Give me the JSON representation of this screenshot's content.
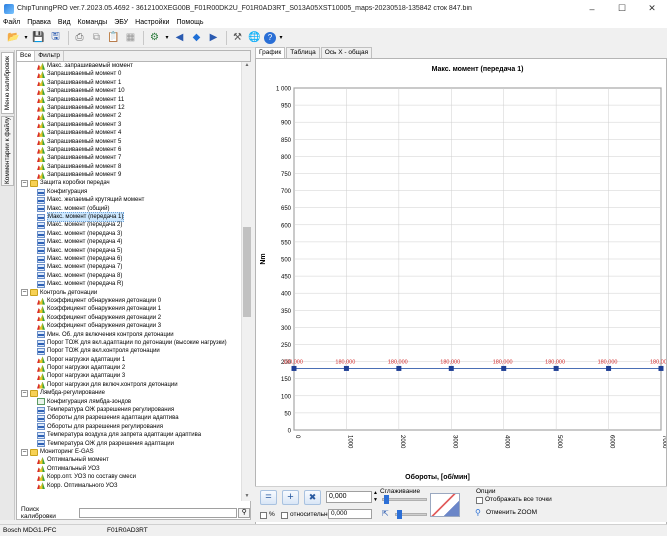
{
  "window": {
    "title": "ChipTuningPRO ver.7.2023.05.4692 - 3612100XEG00B_F01R00DK2U_F01R0AD3RT_S013A05XST10005_maps-20230518-135842 сток 847.bin",
    "minimize": "–",
    "maximize": "☐",
    "close": "✕"
  },
  "menu": [
    "Файл",
    "Правка",
    "Вид",
    "Команды",
    "ЭБУ",
    "Настройки",
    "Помощь"
  ],
  "side_tabs": [
    "Меню калибровок",
    "Комментарии к файлу"
  ],
  "left_tabs": [
    "Все",
    "Фильтр"
  ],
  "tree": [
    {
      "level": 2,
      "icon": "map",
      "label": "Макс. запрашиваемый момент"
    },
    {
      "level": 2,
      "icon": "map",
      "label": "Запрашиваемый момент 0"
    },
    {
      "level": 2,
      "icon": "map",
      "label": "Запрашиваемый момент 1"
    },
    {
      "level": 2,
      "icon": "map",
      "label": "Запрашиваемый момент 10"
    },
    {
      "level": 2,
      "icon": "map",
      "label": "Запрашиваемый момент 11"
    },
    {
      "level": 2,
      "icon": "map",
      "label": "Запрашиваемый момент 12"
    },
    {
      "level": 2,
      "icon": "map",
      "label": "Запрашиваемый момент 2"
    },
    {
      "level": 2,
      "icon": "map",
      "label": "Запрашиваемый момент 3"
    },
    {
      "level": 2,
      "icon": "map",
      "label": "Запрашиваемый момент 4"
    },
    {
      "level": 2,
      "icon": "map",
      "label": "Запрашиваемый момент 5"
    },
    {
      "level": 2,
      "icon": "map",
      "label": "Запрашиваемый момент 6"
    },
    {
      "level": 2,
      "icon": "map",
      "label": "Запрашиваемый момент 7"
    },
    {
      "level": 2,
      "icon": "map",
      "label": "Запрашиваемый момент 8"
    },
    {
      "level": 2,
      "icon": "map",
      "label": "Запрашиваемый момент 9"
    },
    {
      "level": 1,
      "icon": "folder",
      "label": "Защита коробки передач",
      "expander": "–"
    },
    {
      "level": 2,
      "icon": "curve",
      "label": "Конфигурация"
    },
    {
      "level": 2,
      "icon": "curve",
      "label": "Макс. желаемый крутящий момент"
    },
    {
      "level": 2,
      "icon": "curve",
      "label": "Макс. момент (общий)"
    },
    {
      "level": 2,
      "icon": "curve",
      "label": "Макс. момент (передача 1)",
      "selected": true
    },
    {
      "level": 2,
      "icon": "curve",
      "label": "Макс. момент (передача 2)"
    },
    {
      "level": 2,
      "icon": "curve",
      "label": "Макс. момент (передача 3)"
    },
    {
      "level": 2,
      "icon": "curve",
      "label": "Макс. момент (передача 4)"
    },
    {
      "level": 2,
      "icon": "curve",
      "label": "Макс. момент (передача 5)"
    },
    {
      "level": 2,
      "icon": "curve",
      "label": "Макс. момент (передача 6)"
    },
    {
      "level": 2,
      "icon": "curve",
      "label": "Макс. момент (передача 7)"
    },
    {
      "level": 2,
      "icon": "curve",
      "label": "Макс. момент (передача 8)"
    },
    {
      "level": 2,
      "icon": "curve",
      "label": "Макс. момент (передача R)"
    },
    {
      "level": 1,
      "icon": "folder",
      "label": "Контроль детонации",
      "expander": "–"
    },
    {
      "level": 2,
      "icon": "map",
      "label": "Коэффициент обнаружения детонации 0"
    },
    {
      "level": 2,
      "icon": "map",
      "label": "Коэффициент обнаружения детонации 1"
    },
    {
      "level": 2,
      "icon": "map",
      "label": "Коэффициент обнаружения детонации 2"
    },
    {
      "level": 2,
      "icon": "map",
      "label": "Коэффициент обнаружения детонации 3"
    },
    {
      "level": 2,
      "icon": "curve",
      "label": "Мин. Об. для включения контроля детонации"
    },
    {
      "level": 2,
      "icon": "curve",
      "label": "Порог ТОЖ для вкл.адаптации по детонации (высокие нагрузки)"
    },
    {
      "level": 2,
      "icon": "curve",
      "label": "Порог ТОЖ для вкл.контроля детонации"
    },
    {
      "level": 2,
      "icon": "map",
      "label": "Порог нагрузки адаптации 1"
    },
    {
      "level": 2,
      "icon": "map",
      "label": "Порог нагрузки адаптации 2"
    },
    {
      "level": 2,
      "icon": "map",
      "label": "Порог нагрузки адаптации 3"
    },
    {
      "level": 2,
      "icon": "map",
      "label": "Порог нагрузки для включ.контроля детонации"
    },
    {
      "level": 1,
      "icon": "folder",
      "label": "Лямбда-регулирование",
      "expander": "–"
    },
    {
      "level": 2,
      "icon": "tbl",
      "label": "Конфигурация лямбда-зондов"
    },
    {
      "level": 2,
      "icon": "curve",
      "label": "Температура ОЖ разрешения регулирования"
    },
    {
      "level": 2,
      "icon": "curve",
      "label": "Обороты для разрешения адаптации адаптива"
    },
    {
      "level": 2,
      "icon": "curve",
      "label": "Обороты для разрешения регулирования"
    },
    {
      "level": 2,
      "icon": "curve",
      "label": "Температура воздуха для запрета адаптации адаптива"
    },
    {
      "level": 2,
      "icon": "curve",
      "label": "Температура ОЖ для разрешения адаптации"
    },
    {
      "level": 1,
      "icon": "folder",
      "label": "Мониторинг E-GAS",
      "expander": "–"
    },
    {
      "level": 2,
      "icon": "map",
      "label": "Оптимальный момент"
    },
    {
      "level": 2,
      "icon": "map",
      "label": "Оптимальный УОЗ"
    },
    {
      "level": 2,
      "icon": "map",
      "label": "Корр.опт. УОЗ по составу смеси"
    },
    {
      "level": 2,
      "icon": "map",
      "label": "Корр. Оптимального УОЗ"
    }
  ],
  "search": {
    "label": "Поиск калибровки",
    "value": ""
  },
  "right_tabs": [
    "График",
    "Таблица",
    "Ось X - общая"
  ],
  "chart_data": {
    "type": "line",
    "title": "Макс. момент (передача 1)",
    "xlabel": "Обороты, [об/мин]",
    "ylabel": "Nm",
    "x": [
      0,
      1000,
      2000,
      3000,
      4000,
      5000,
      6000,
      7000
    ],
    "series": [
      {
        "values": [
          180,
          180,
          180,
          180,
          180,
          180,
          180,
          180
        ]
      }
    ],
    "data_labels": [
      "180,000",
      "180,000",
      "180,000",
      "180,000",
      "180,000",
      "180,000",
      "180,000",
      "180,00"
    ],
    "xlim": [
      0,
      7000
    ],
    "ylim": [
      0,
      1000
    ],
    "yticks": [
      "0",
      "50",
      "100",
      "150",
      "200",
      "250",
      "300",
      "350",
      "400",
      "450",
      "500",
      "550",
      "600",
      "650",
      "700",
      "750",
      "800",
      "850",
      "900",
      "950",
      "1 000"
    ],
    "xticks": [
      "0",
      "1000",
      "2000",
      "3000",
      "4000",
      "5000",
      "6000",
      "7000"
    ],
    "grid": true,
    "line_color": "#4a6fb5",
    "marker_color": "#1f3f95",
    "label_color": "#d12b2b"
  },
  "controls": {
    "value1": "0,000",
    "value2": "0,000",
    "smoothing_label": "Сглаживание",
    "options_label": "Опции",
    "show_all_points": "Отображать все точки",
    "cancel_zoom": "Отменить ZOOM",
    "percent": "%",
    "relative": "относительно",
    "plus": "+",
    "multiply": "✖",
    "equals": "="
  },
  "status": {
    "ecu": "Bosch MDG1.PFC",
    "sw": "F01R0AD3RT"
  }
}
